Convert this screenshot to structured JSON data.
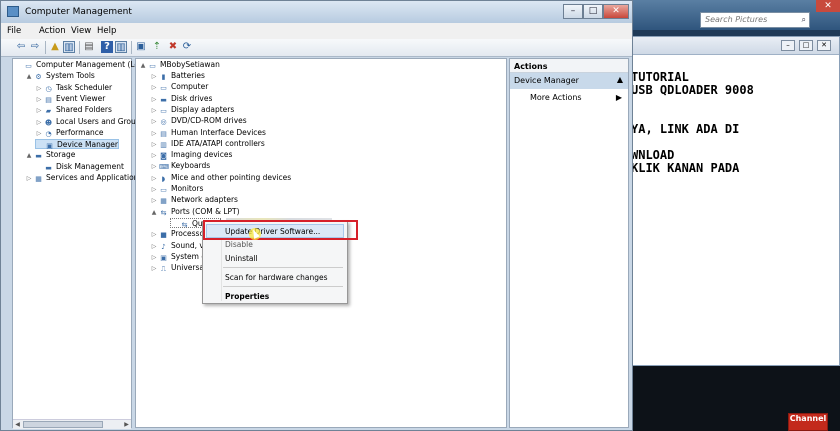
{
  "background_window": {
    "search_placeholder": "Search Pictures",
    "document_lines": [
      "TUTORIAL",
      "USB QDLOADER 9008",
      "",
      "",
      "YA, LINK ADA DI",
      "",
      "WNLOAD",
      "KLIK KANAN PADA"
    ]
  },
  "watermark": "Channel",
  "window": {
    "title": "Computer Management"
  },
  "menu": [
    "File",
    "Action",
    "View",
    "Help"
  ],
  "left_tree": [
    {
      "label": "Computer Management (Local",
      "level": 0,
      "expander": "",
      "icon": "computer-icon"
    },
    {
      "label": "System Tools",
      "level": 1,
      "expander": "▲",
      "icon": "tools-icon"
    },
    {
      "label": "Task Scheduler",
      "level": 2,
      "expander": "▷",
      "icon": "clock-icon"
    },
    {
      "label": "Event Viewer",
      "level": 2,
      "expander": "▷",
      "icon": "event-icon"
    },
    {
      "label": "Shared Folders",
      "level": 2,
      "expander": "▷",
      "icon": "folder-icon"
    },
    {
      "label": "Local Users and Groups",
      "level": 2,
      "expander": "▷",
      "icon": "users-icon"
    },
    {
      "label": "Performance",
      "level": 2,
      "expander": "▷",
      "icon": "performance-icon"
    },
    {
      "label": "Device Manager",
      "level": 2,
      "expander": "",
      "icon": "device-manager-icon",
      "selected": true
    },
    {
      "label": "Storage",
      "level": 1,
      "expander": "▲",
      "icon": "storage-icon"
    },
    {
      "label": "Disk Management",
      "level": 2,
      "expander": "",
      "icon": "disk-icon"
    },
    {
      "label": "Services and Applications",
      "level": 1,
      "expander": "▷",
      "icon": "services-icon"
    }
  ],
  "device_tree": {
    "root": "MBobySetiawan",
    "categories": [
      {
        "label": "Batteries",
        "icon": "battery-icon"
      },
      {
        "label": "Computer",
        "icon": "computer-icon"
      },
      {
        "label": "Disk drives",
        "icon": "disk-drive-icon"
      },
      {
        "label": "Display adapters",
        "icon": "display-icon"
      },
      {
        "label": "DVD/CD-ROM drives",
        "icon": "dvd-icon"
      },
      {
        "label": "Human Interface Devices",
        "icon": "hid-icon"
      },
      {
        "label": "IDE ATA/ATAPI controllers",
        "icon": "ide-icon"
      },
      {
        "label": "Imaging devices",
        "icon": "camera-icon"
      },
      {
        "label": "Keyboards",
        "icon": "keyboard-icon"
      },
      {
        "label": "Mice and other pointing devices",
        "icon": "mouse-icon"
      },
      {
        "label": "Monitors",
        "icon": "monitor-icon"
      },
      {
        "label": "Network adapters",
        "icon": "network-icon"
      },
      {
        "label": "Ports (COM & LPT)",
        "icon": "port-icon",
        "expanded": true
      },
      {
        "label": "Qualco",
        "icon": "port-device-icon",
        "child": true
      },
      {
        "label": "Processo",
        "icon": "processor-icon"
      },
      {
        "label": "Sound, v",
        "icon": "sound-icon"
      },
      {
        "label": "System d",
        "icon": "system-icon"
      },
      {
        "label": "Universal",
        "icon": "usb-icon"
      }
    ]
  },
  "context_menu": {
    "update": "Update Driver Software...",
    "disable": "Disable",
    "uninstall": "Uninstall",
    "scan": "Scan for hardware changes",
    "properties": "Properties"
  },
  "actions_pane": {
    "header": "Actions",
    "section": "Device Manager",
    "more": "More Actions"
  },
  "colors": {
    "highlight_box": "#d6202a",
    "selection": "#cce1f5"
  }
}
